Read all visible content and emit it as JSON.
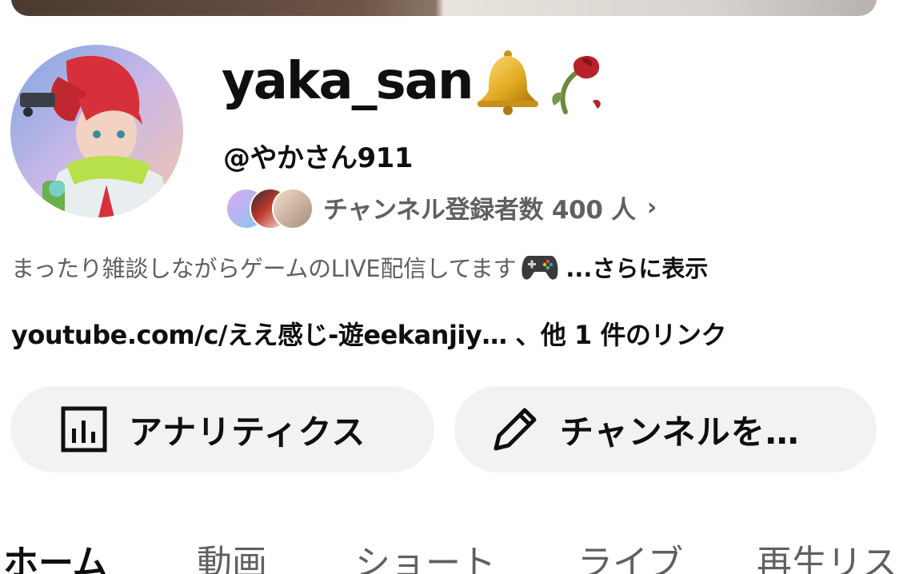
{
  "channel": {
    "name": "yaka_san",
    "handle": "@やかさん911",
    "subscribers_label": "チャンネル登録者数 400 人",
    "description": "まったり雑談しながらゲームのLIVE配信してます",
    "more_label": "...さらに表示",
    "links_label": "youtube.com/c/ええ感じ-遊eekanjiy… 、他 1 件のリンク"
  },
  "icons": {
    "name_emojis": [
      "bell-emoji",
      "wilted-rose-emoji"
    ],
    "description_emoji": "game-controller-emoji",
    "subscribers_chevron": "chevron-right-icon",
    "analytics": "analytics-chart-icon",
    "edit": "pencil-icon"
  },
  "buttons": {
    "analytics_label": "アナリティクス",
    "edit_label": "チャンネルを…"
  },
  "tabs": [
    {
      "label": "ホーム",
      "active": true
    },
    {
      "label": "動画",
      "active": false
    },
    {
      "label": "ショート",
      "active": false
    },
    {
      "label": "ライブ",
      "active": false
    },
    {
      "label": "再生リス",
      "active": false
    }
  ],
  "colors": {
    "primary_text": "#0f0f0f",
    "secondary_text": "#606060",
    "button_bg": "#f2f2f2"
  }
}
